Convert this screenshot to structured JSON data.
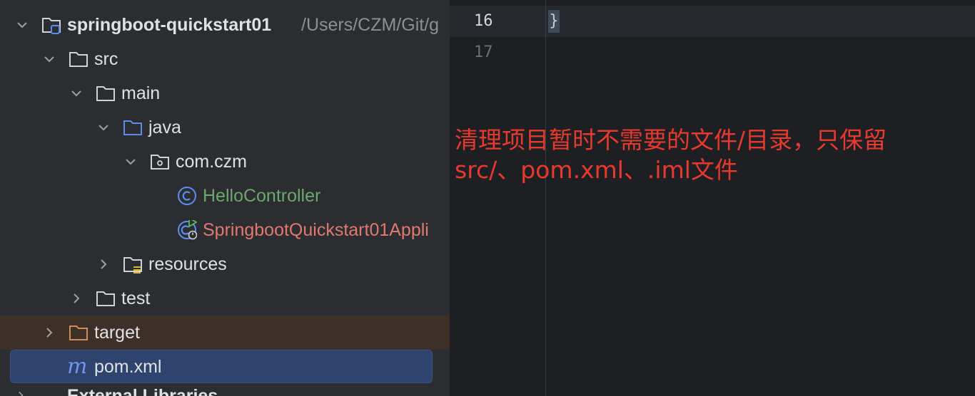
{
  "project_tree": {
    "root": {
      "name": "springboot-quickstart01",
      "path": "/Users/CZM/Git/g"
    },
    "nodes": [
      {
        "label": "src"
      },
      {
        "label": "main"
      },
      {
        "label": "java"
      },
      {
        "label": "com.czm"
      },
      {
        "label": "HelloController"
      },
      {
        "label": "SpringbootQuickstart01Appli"
      },
      {
        "label": "resources"
      },
      {
        "label": "test"
      },
      {
        "label": "target"
      },
      {
        "label": "pom.xml",
        "icon_text": "m"
      }
    ],
    "bottom_partial": "External Libraries"
  },
  "editor": {
    "line_numbers": [
      "16",
      "17"
    ],
    "code_line_16": "}"
  },
  "annotation": {
    "line1": "清理项目暂时不需要的文件/目录，只保留",
    "line2": "src/、pom.xml、.iml文件"
  },
  "colors": {
    "panel_bg": "#2b2d30",
    "editor_bg": "#1e1f22",
    "selection": "#2e436e",
    "excluded_row": "#3d3127",
    "annotation_red": "#e8392f",
    "class_green": "#6ca86c",
    "app_class_red": "#e07a6e"
  },
  "icons": {
    "module": "module-folder-icon",
    "folder": "folder-icon",
    "source_root": "source-root-folder-icon",
    "package": "package-icon",
    "class": "class-icon",
    "spring_app": "spring-boot-app-icon",
    "resources": "resources-folder-icon",
    "excluded": "excluded-folder-icon",
    "maven": "maven-icon"
  }
}
